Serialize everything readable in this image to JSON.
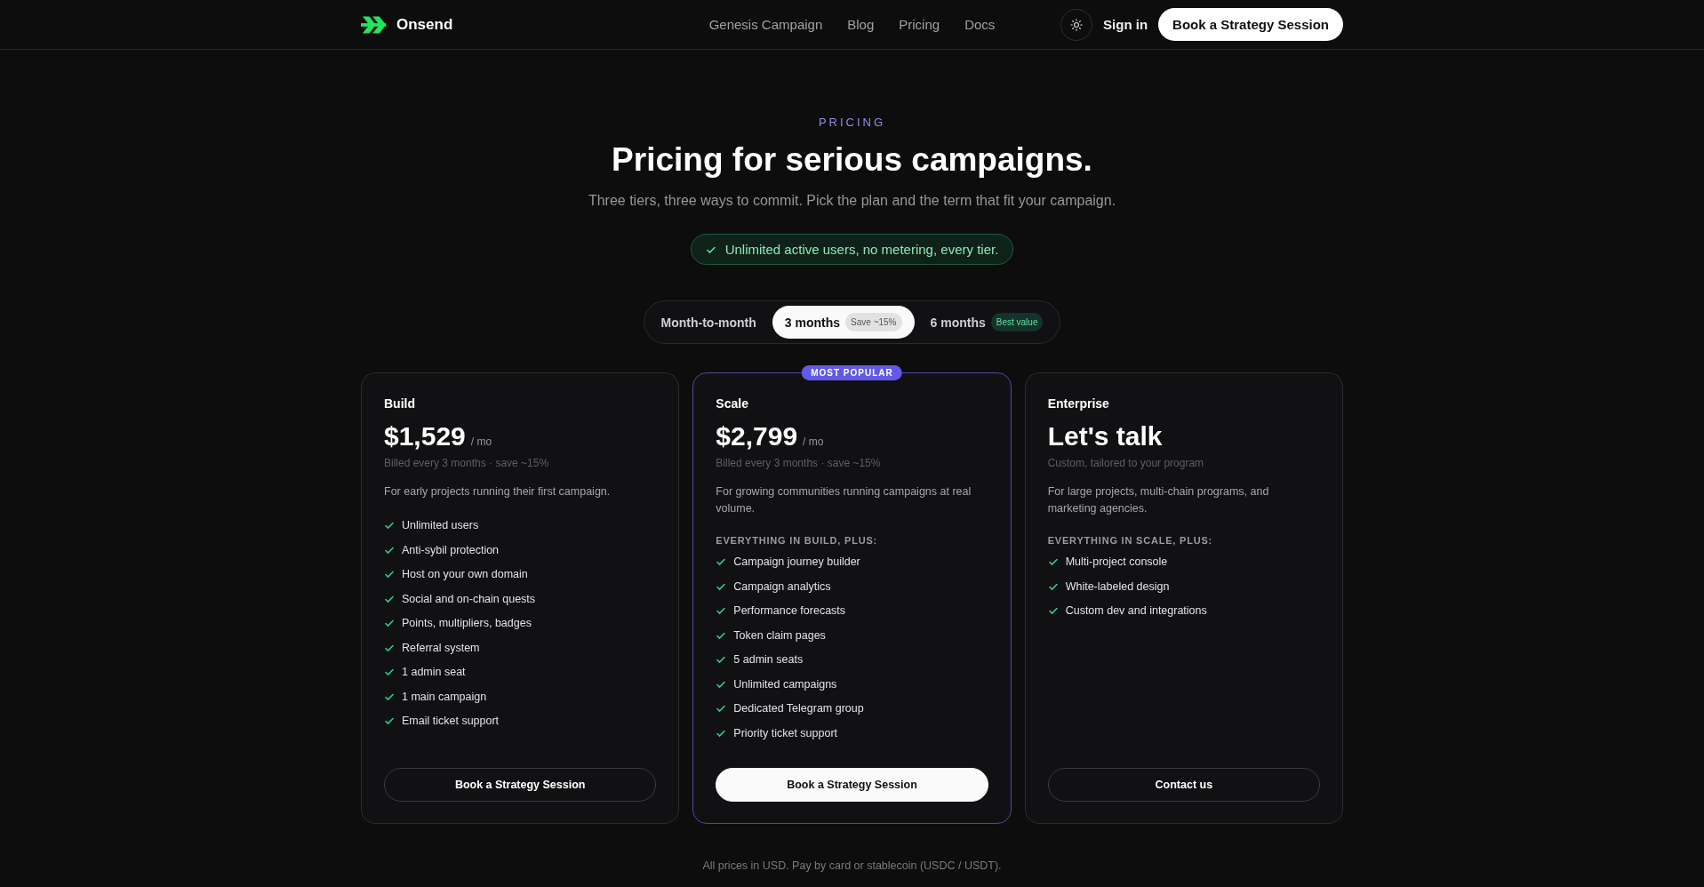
{
  "nav": {
    "brand": "Onsend",
    "links": [
      "Genesis Campaign",
      "Blog",
      "Pricing",
      "Docs"
    ],
    "sign_in": "Sign in",
    "cta": "Book a Strategy Session"
  },
  "hero": {
    "eyebrow": "PRICING",
    "title": "Pricing for serious campaigns.",
    "subtitle": "Three tiers, three ways to commit. Pick the plan and the term that fit your campaign.",
    "notice": "Unlimited active users, no metering, every tier."
  },
  "terms": [
    {
      "label": "Month-to-month",
      "selected": false
    },
    {
      "label": "3 months",
      "badge": "Save ~15%",
      "selected": true
    },
    {
      "label": "6 months",
      "badge": "Best value",
      "selected": false
    }
  ],
  "plans": [
    {
      "name": "Build",
      "price": "$1,529",
      "unit": "/ mo",
      "billing": "Billed every 3 months · save ~15%",
      "description": "For early projects running their first campaign.",
      "features": [
        "Unlimited users",
        "Anti-sybil protection",
        "Host on your own domain",
        "Social and on-chain quests",
        "Points, multipliers, badges",
        "Referral system",
        "1 admin seat",
        "1 main campaign",
        "Email ticket support"
      ],
      "button": "Book a Strategy Session",
      "featured": false
    },
    {
      "name": "Scale",
      "badge": "MOST POPULAR",
      "price": "$2,799",
      "unit": "/ mo",
      "billing": "Billed every 3 months · save ~15%",
      "description": "For growing communities running campaigns at real volume.",
      "features_heading": "EVERYTHING IN BUILD, PLUS:",
      "features": [
        "Campaign journey builder",
        "Campaign analytics",
        "Performance forecasts",
        "Token claim pages",
        "5 admin seats",
        "Unlimited campaigns",
        "Dedicated Telegram group",
        "Priority ticket support"
      ],
      "button": "Book a Strategy Session",
      "featured": true
    },
    {
      "name": "Enterprise",
      "price": "Let's talk",
      "billing": "Custom, tailored to your program",
      "description": "For large projects, multi-chain programs, and marketing agencies.",
      "features_heading": "EVERYTHING IN SCALE, PLUS:",
      "features": [
        "Multi-project console",
        "White-labeled design",
        "Custom dev and integrations"
      ],
      "button": "Contact us",
      "featured": false
    }
  ],
  "footer_note": "All prices in USD. Pay by card or stablecoin (USDC / USDT)."
}
